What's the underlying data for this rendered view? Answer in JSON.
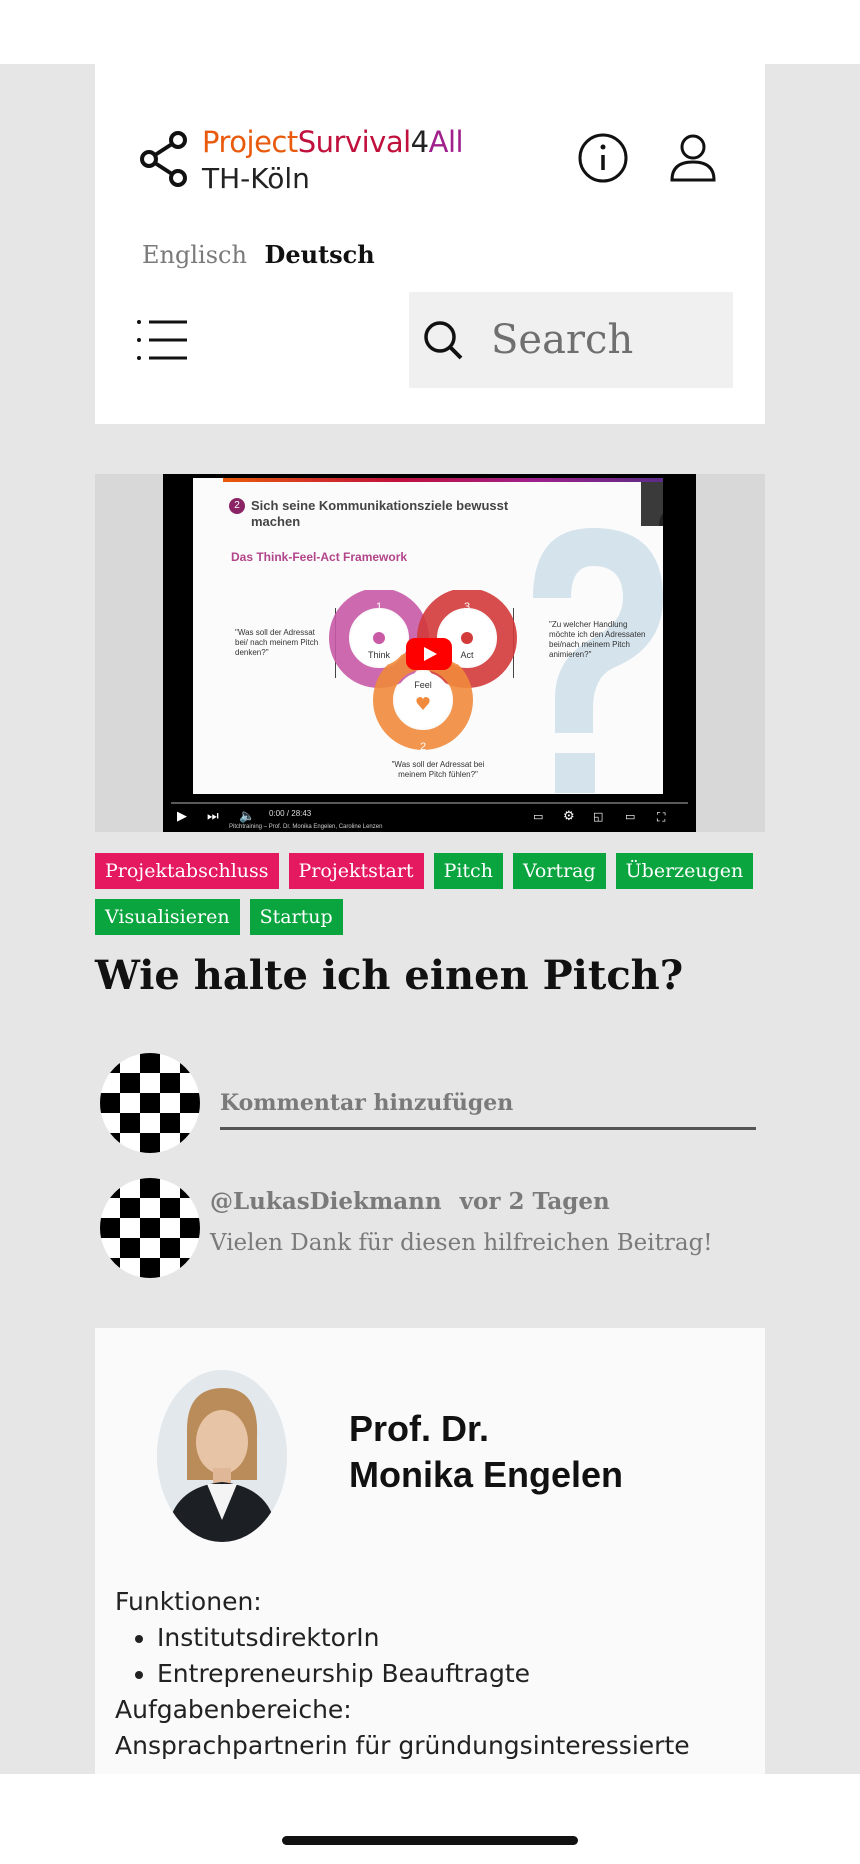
{
  "header": {
    "brand": {
      "part1": "Project",
      "part2": "Survival",
      "part3": "4",
      "part4": "All",
      "subtitle": "TH-Köln"
    },
    "languages": {
      "english": "Englisch",
      "german": "Deutsch",
      "active": "Deutsch"
    },
    "search": {
      "placeholder": "Search"
    },
    "icons": [
      "share-icon",
      "info-icon",
      "user-icon",
      "menu-icon",
      "search-icon"
    ]
  },
  "video": {
    "slide_number": "2",
    "slide_title": "Sich seine Kommunikationsziele bewusst machen",
    "slide_subtitle": "Das Think-Feel-Act Framework",
    "left_question": "\"Was soll der Adressat bei/ nach meinem Pitch denken?\"",
    "right_question": "\"Zu welcher Handlung möchte ich den Adressaten bei/nach meinem Pitch animieren?\"",
    "bottom_question": "\"Was soll der Adressat bei meinem Pitch fühlen?\"",
    "circle_think": {
      "num": "1",
      "label": "Think"
    },
    "circle_act": {
      "num": "3",
      "label": "Act"
    },
    "circle_feel": {
      "num": "2",
      "label": "Feel"
    },
    "time": "0:00 / 28:43",
    "caption": "Pitchtraining – Prof. Dr. Monika Engelen, Caroline Lenzen"
  },
  "tags": [
    {
      "label": "Projektabschluss",
      "color": "red"
    },
    {
      "label": "Projektstart",
      "color": "red"
    },
    {
      "label": "Pitch",
      "color": "green"
    },
    {
      "label": "Vortrag",
      "color": "green"
    },
    {
      "label": "Überzeugen",
      "color": "green"
    },
    {
      "label": "Visualisieren",
      "color": "green"
    },
    {
      "label": "Startup",
      "color": "green"
    }
  ],
  "post": {
    "title": "Wie halte ich einen Pitch?"
  },
  "comments": {
    "add_placeholder": "Kommentar hinzufügen",
    "items": [
      {
        "user": "@LukasDiekmann",
        "when": "vor 2 Tagen",
        "text": "Vielen Dank für diesen hilfreichen Beitrag!"
      }
    ]
  },
  "profile": {
    "name_line1": "Prof. Dr.",
    "name_line2": "Monika Engelen",
    "functions_label": "Funktionen:",
    "functions": [
      "InstitutsdirektorIn",
      "Entrepreneurship Beauftragte"
    ],
    "tasks_label": "Aufgabenbereiche:",
    "tasks_text": "Ansprachpartnerin für gründungsinteressierte"
  },
  "colors": {
    "tag_red": "#e5195f",
    "tag_green": "#0ba540",
    "brand_orange": "#e95a0c",
    "brand_red": "#c0103c",
    "brand_purple": "#a0208c",
    "page_bg": "#e6e6e6"
  }
}
